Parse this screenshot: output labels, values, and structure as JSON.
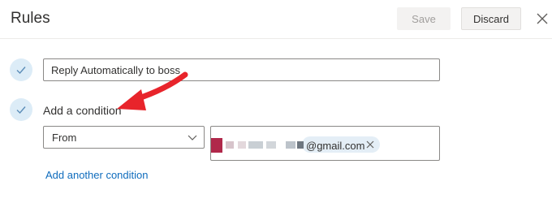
{
  "header": {
    "title": "Rules",
    "save_label": "Save",
    "discard_label": "Discard"
  },
  "rule": {
    "name_value": "Reply Automatically to boss"
  },
  "condition": {
    "label": "Add a condition",
    "field_selected": "From",
    "recipient_email_suffix": "@gmail.com",
    "add_another_label": "Add another condition"
  },
  "colors": {
    "accent": "#0f6cbd",
    "check_bg": "#dcecf7",
    "annotation_arrow": "#e8242b"
  },
  "icons": [
    "close-icon",
    "checkmark-icon",
    "chevron-down-icon",
    "remove-icon",
    "red-arrow-annotation"
  ]
}
